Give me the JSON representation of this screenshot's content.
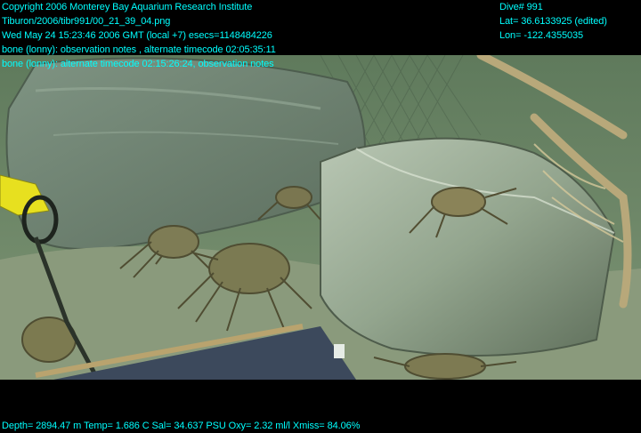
{
  "overlay_left": [
    "Copyright 2006 Monterey Bay Aquarium Research Institute",
    "Tiburon/2006/tibr991/00_21_39_04.png",
    "Wed May 24 15:23:46 2006 GMT (local +7)  esecs=1148484226",
    "bone (lonny): observation notes , alternate timecode 02:05:35:11",
    "bone (lonny): alternate timecode 02:15:26:24, observation notes"
  ],
  "overlay_right": [
    "Dive# 991",
    "Lat= 36.6133925 (edited)",
    "Lon= -122.4355035"
  ],
  "telemetry": "Depth= 2894.47 m  Temp= 1.686 C  Sal= 34.637 PSU  Oxy= 2.32 ml/l  Xmiss= 84.06%",
  "colors": {
    "overlay_text": "#00ffff",
    "background": "#000000",
    "water": "#6f8a6a",
    "seafloor": "#8a9a7c"
  }
}
